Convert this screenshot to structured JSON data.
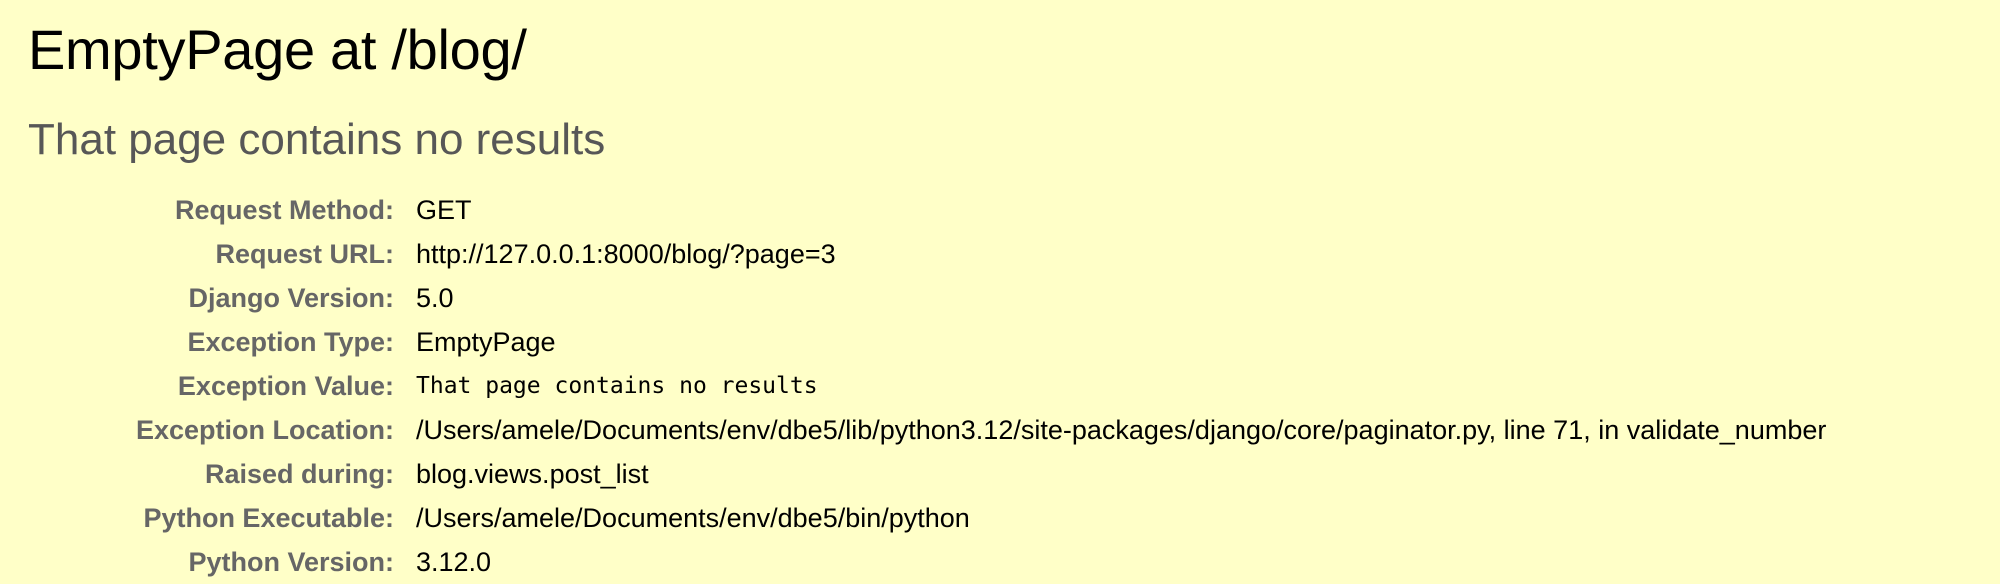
{
  "title": "EmptyPage at /blog/",
  "subtitle": "That page contains no results",
  "meta": [
    {
      "label": "Request Method:",
      "value": "GET"
    },
    {
      "label": "Request URL:",
      "value": "http://127.0.0.1:8000/blog/?page=3"
    },
    {
      "label": "Django Version:",
      "value": "5.0"
    },
    {
      "label": "Exception Type:",
      "value": "EmptyPage"
    },
    {
      "label": "Exception Value:",
      "value": "That page contains no results"
    },
    {
      "label": "Exception Location:",
      "value": "/Users/amele/Documents/env/dbe5/lib/python3.12/site-packages/django/core/paginator.py, line 71, in validate_number"
    },
    {
      "label": "Raised during:",
      "value": "blog.views.post_list"
    },
    {
      "label": "Python Executable:",
      "value": "/Users/amele/Documents/env/dbe5/bin/python"
    },
    {
      "label": "Python Version:",
      "value": "3.12.0"
    }
  ]
}
